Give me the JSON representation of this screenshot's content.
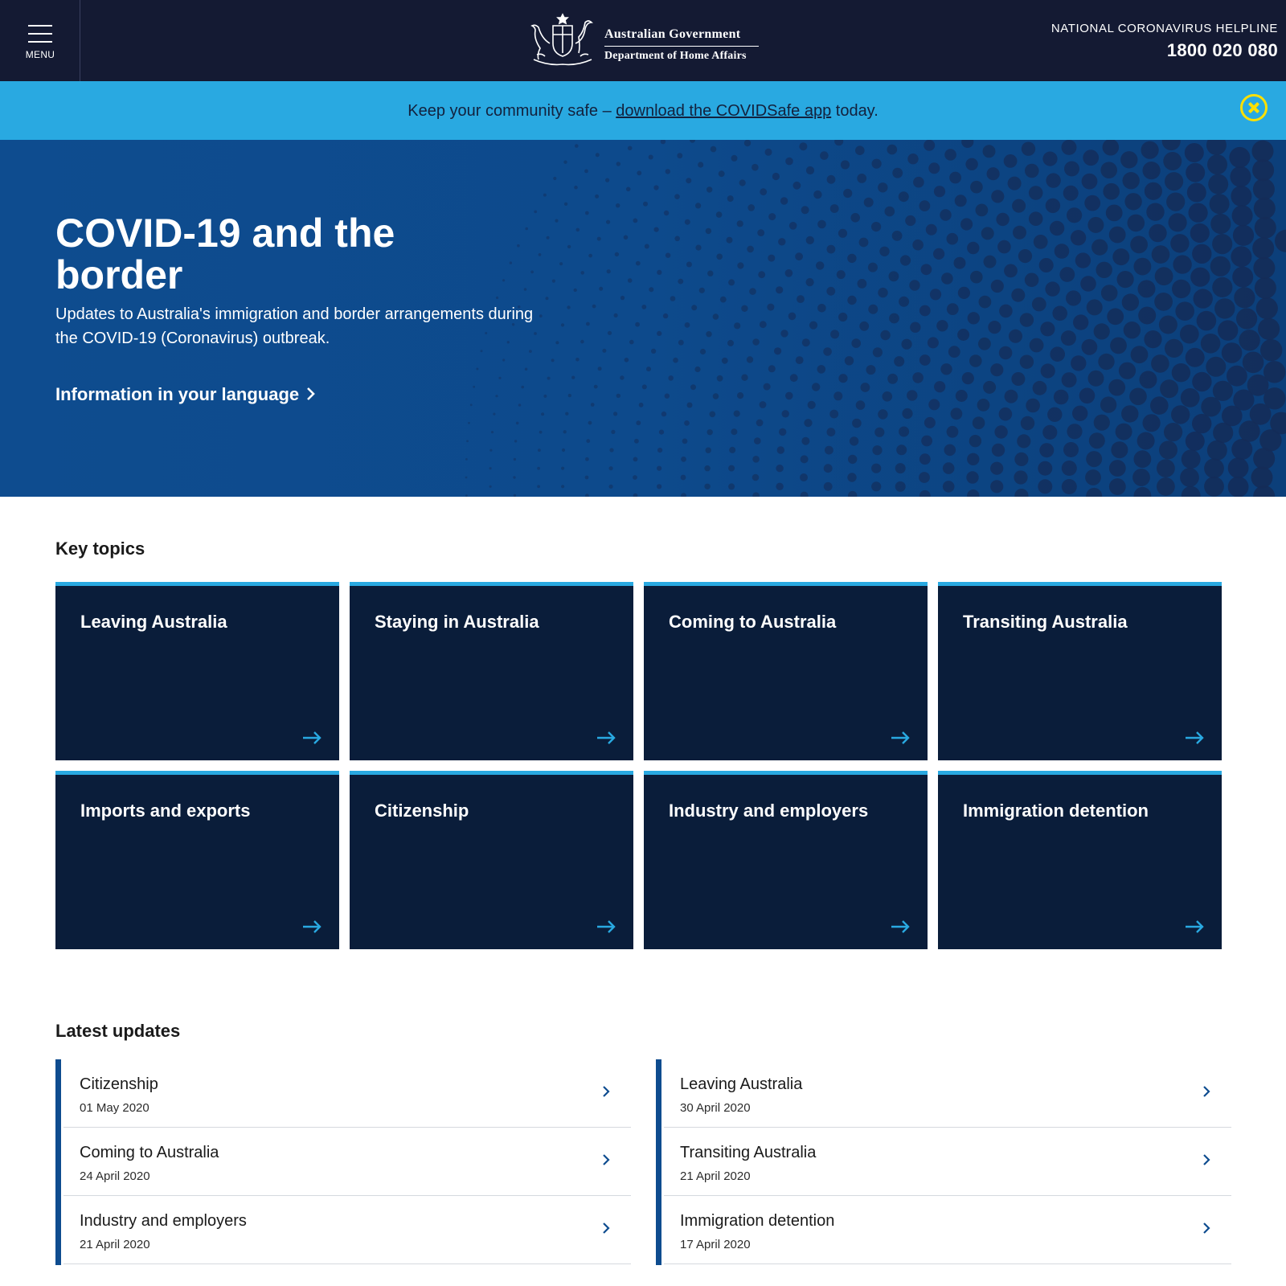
{
  "header": {
    "menu_label": "MENU",
    "gov_line1": "Australian Government",
    "gov_line2": "Department of Home Affairs",
    "helpline_label": "NATIONAL CORONAVIRUS HELPLINE",
    "helpline_number": "1800 020 080"
  },
  "alert": {
    "text_before": "Keep your community safe – ",
    "link_text": "download the COVIDSafe app",
    "text_after": " today."
  },
  "hero": {
    "title": "COVID-19 and the border",
    "subtitle": "Updates to Australia's immigration and border arrangements during the COVID-19 (Coronavirus) outbreak.",
    "language_link": "Information in your language"
  },
  "key_topics": {
    "title": "Key topics",
    "tiles": [
      {
        "label": "Leaving Australia"
      },
      {
        "label": "Staying in Australia"
      },
      {
        "label": "Coming to Australia"
      },
      {
        "label": "Transiting Australia"
      },
      {
        "label": "Imports and exports"
      },
      {
        "label": "Citizenship"
      },
      {
        "label": "Industry and employers"
      },
      {
        "label": "Immigration detention"
      }
    ]
  },
  "latest_updates": {
    "title": "Latest updates",
    "left": [
      {
        "title": "Citizenship",
        "date": "01 May 2020"
      },
      {
        "title": "Coming to Australia",
        "date": "24 April 2020"
      },
      {
        "title": "Industry and employers",
        "date": "21 April 2020"
      }
    ],
    "right": [
      {
        "title": "Leaving Australia",
        "date": "30 April 2020"
      },
      {
        "title": "Transiting Australia",
        "date": "21 April 2020"
      },
      {
        "title": "Immigration detention",
        "date": "17 April 2020"
      }
    ]
  },
  "colors": {
    "header_bg": "#141a33",
    "alert_bg": "#29a9e1",
    "close_icon": "#ffe000",
    "hero_bg": "#0e4c8f",
    "tile_bg": "#0a1d3a",
    "accent": "#29a9e1"
  },
  "icons": {
    "menu": "hamburger-icon",
    "close": "close-circle-icon",
    "tile_arrow": "arrow-right-icon",
    "update_chevron": "chevron-right-icon",
    "logo": "coat-of-arms-icon"
  }
}
